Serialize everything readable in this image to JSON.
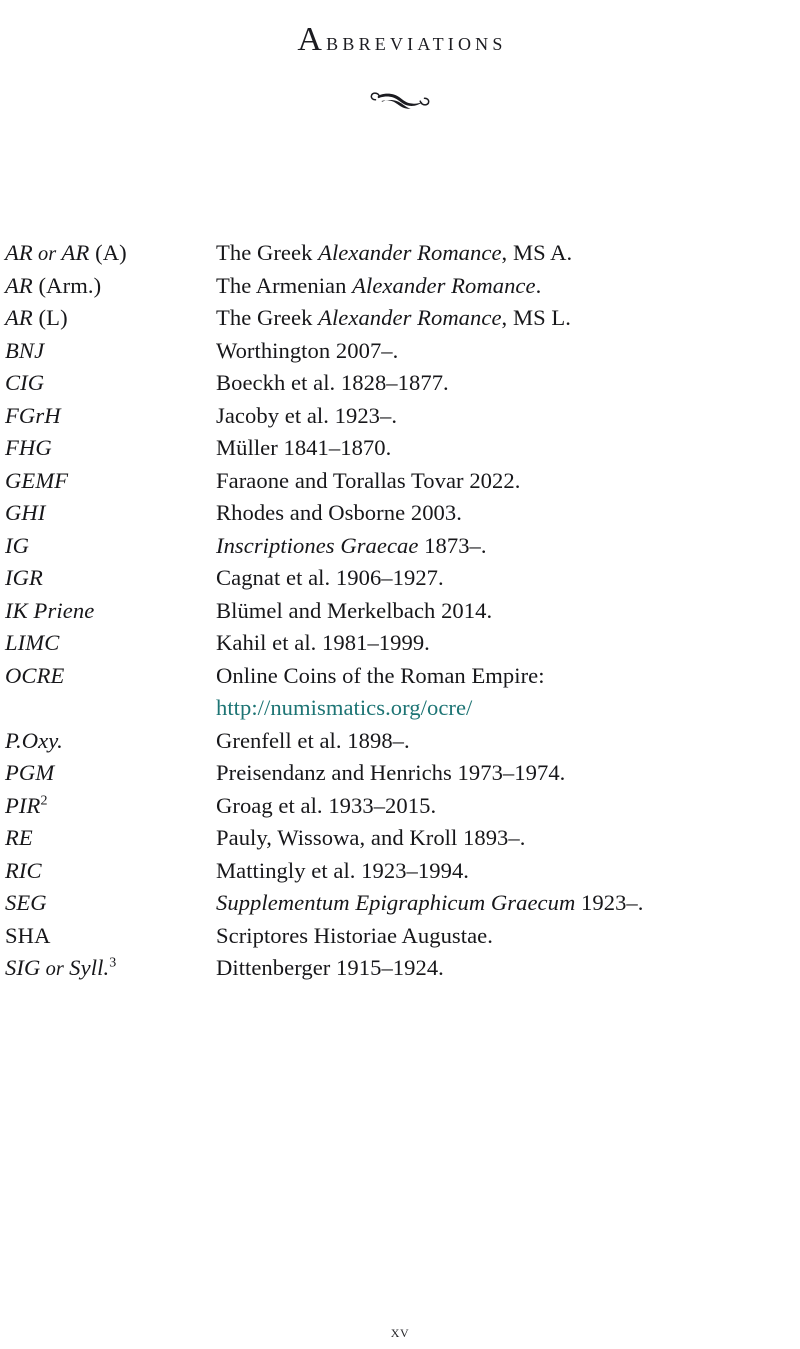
{
  "page": {
    "title_first_letter": "A",
    "title_rest": "bbreviations",
    "title_full": "Abbreviations",
    "folio": "xv",
    "ornament_name": "swash-flourish-ornament",
    "link_color": "#1d7474",
    "text_color": "#17171a",
    "background_color": "#ffffff"
  },
  "entries": [
    {
      "term_parts": [
        {
          "text": "AR",
          "style": "italic"
        },
        {
          "text": " or ",
          "style": "conj"
        },
        {
          "text": "AR",
          "style": "italic"
        },
        {
          "text": " (A)",
          "style": "roman"
        }
      ],
      "term_plain": "AR or AR (A)",
      "def_parts": [
        {
          "text": "The Greek ",
          "style": "roman"
        },
        {
          "text": "Alexander Romance",
          "style": "italic"
        },
        {
          "text": ", MS A.",
          "style": "roman"
        }
      ],
      "def_plain": "The Greek Alexander Romance, MS A."
    },
    {
      "term_parts": [
        {
          "text": "AR",
          "style": "italic"
        },
        {
          "text": " (Arm.)",
          "style": "roman"
        }
      ],
      "term_plain": "AR (Arm.)",
      "def_parts": [
        {
          "text": "The Armenian ",
          "style": "roman"
        },
        {
          "text": "Alexander Romance",
          "style": "italic"
        },
        {
          "text": ".",
          "style": "roman"
        }
      ],
      "def_plain": "The Armenian Alexander Romance."
    },
    {
      "term_parts": [
        {
          "text": "AR",
          "style": "italic"
        },
        {
          "text": " (L)",
          "style": "roman"
        }
      ],
      "term_plain": "AR (L)",
      "def_parts": [
        {
          "text": "The Greek ",
          "style": "roman"
        },
        {
          "text": "Alexander Romance",
          "style": "italic"
        },
        {
          "text": ", MS L.",
          "style": "roman"
        }
      ],
      "def_plain": "The Greek Alexander Romance, MS L."
    },
    {
      "term_parts": [
        {
          "text": "BNJ",
          "style": "italic"
        }
      ],
      "term_plain": "BNJ",
      "def_parts": [
        {
          "text": "Worthington 2007–.",
          "style": "roman"
        }
      ],
      "def_plain": "Worthington 2007–."
    },
    {
      "term_parts": [
        {
          "text": "CIG",
          "style": "italic"
        }
      ],
      "term_plain": "CIG",
      "def_parts": [
        {
          "text": "Boeckh et al. 1828–1877.",
          "style": "roman"
        }
      ],
      "def_plain": "Boeckh et al. 1828–1877."
    },
    {
      "term_parts": [
        {
          "text": "FGrH",
          "style": "italic"
        }
      ],
      "term_plain": "FGrH",
      "def_parts": [
        {
          "text": "Jacoby et al. 1923–.",
          "style": "roman"
        }
      ],
      "def_plain": "Jacoby et al. 1923–."
    },
    {
      "term_parts": [
        {
          "text": "FHG",
          "style": "italic"
        }
      ],
      "term_plain": "FHG",
      "def_parts": [
        {
          "text": "Müller 1841–1870.",
          "style": "roman"
        }
      ],
      "def_plain": "Müller 1841–1870."
    },
    {
      "term_parts": [
        {
          "text": "GEMF",
          "style": "italic"
        }
      ],
      "term_plain": "GEMF",
      "def_parts": [
        {
          "text": "Faraone and Torallas Tovar 2022.",
          "style": "roman"
        }
      ],
      "def_plain": "Faraone and Torallas Tovar 2022."
    },
    {
      "term_parts": [
        {
          "text": "GHI",
          "style": "italic"
        }
      ],
      "term_plain": "GHI",
      "def_parts": [
        {
          "text": "Rhodes and Osborne 2003.",
          "style": "roman"
        }
      ],
      "def_plain": "Rhodes and Osborne 2003."
    },
    {
      "term_parts": [
        {
          "text": "IG",
          "style": "italic"
        }
      ],
      "term_plain": "IG",
      "def_parts": [
        {
          "text": "Inscriptiones Graecae",
          "style": "italic"
        },
        {
          "text": " 1873–.",
          "style": "roman"
        }
      ],
      "def_plain": "Inscriptiones Graecae 1873–."
    },
    {
      "term_parts": [
        {
          "text": "IGR",
          "style": "italic"
        }
      ],
      "term_plain": "IGR",
      "def_parts": [
        {
          "text": "Cagnat et al. 1906–1927.",
          "style": "roman"
        }
      ],
      "def_plain": "Cagnat et al. 1906–1927."
    },
    {
      "term_parts": [
        {
          "text": "IK Priene",
          "style": "italic"
        }
      ],
      "term_plain": "IK Priene",
      "def_parts": [
        {
          "text": "Blümel and Merkelbach 2014.",
          "style": "roman"
        }
      ],
      "def_plain": "Blümel and Merkelbach 2014."
    },
    {
      "term_parts": [
        {
          "text": "LIMC",
          "style": "italic"
        }
      ],
      "term_plain": "LIMC",
      "def_parts": [
        {
          "text": "Kahil et al. 1981–1999.",
          "style": "roman"
        }
      ],
      "def_plain": "Kahil et al. 1981–1999."
    },
    {
      "term_parts": [
        {
          "text": "OCRE",
          "style": "italic"
        }
      ],
      "term_plain": "OCRE",
      "def_parts": [
        {
          "text": "Online Coins of the Roman Empire: ",
          "style": "roman"
        },
        {
          "text": "http://numismatics.org/ocre/",
          "style": "link"
        }
      ],
      "def_plain": "Online Coins of the Roman Empire: http://numismatics.org/ocre/"
    },
    {
      "term_parts": [
        {
          "text": "P.Oxy.",
          "style": "italic"
        }
      ],
      "term_plain": "P.Oxy.",
      "def_parts": [
        {
          "text": "Grenfell et al. 1898–.",
          "style": "roman"
        }
      ],
      "def_plain": "Grenfell et al. 1898–."
    },
    {
      "term_parts": [
        {
          "text": "PGM",
          "style": "italic"
        }
      ],
      "term_plain": "PGM",
      "def_parts": [
        {
          "text": "Preisendanz and Henrichs 1973–1974.",
          "style": "roman"
        }
      ],
      "def_plain": "Preisendanz and Henrichs 1973–1974."
    },
    {
      "term_parts": [
        {
          "text": "PIR",
          "style": "italic"
        },
        {
          "text": "2",
          "style": "sup"
        }
      ],
      "term_plain": "PIR2",
      "def_parts": [
        {
          "text": "Groag et al. 1933–2015.",
          "style": "roman"
        }
      ],
      "def_plain": "Groag et al. 1933–2015."
    },
    {
      "term_parts": [
        {
          "text": "RE",
          "style": "italic"
        }
      ],
      "term_plain": "RE",
      "def_parts": [
        {
          "text": "Pauly, Wissowa, and Kroll 1893–.",
          "style": "roman"
        }
      ],
      "def_plain": "Pauly, Wissowa, and Kroll 1893–."
    },
    {
      "term_parts": [
        {
          "text": "RIC",
          "style": "italic"
        }
      ],
      "term_plain": "RIC",
      "def_parts": [
        {
          "text": "Mattingly et al. 1923–1994.",
          "style": "roman"
        }
      ],
      "def_plain": "Mattingly et al. 1923–1994."
    },
    {
      "term_parts": [
        {
          "text": "SEG",
          "style": "italic"
        }
      ],
      "term_plain": "SEG",
      "def_parts": [
        {
          "text": "Supplementum Epigraphicum Graecum",
          "style": "italic"
        },
        {
          "text": " 1923–.",
          "style": "roman"
        }
      ],
      "def_plain": "Supplementum Epigraphicum Graecum 1923–."
    },
    {
      "term_parts": [
        {
          "text": "SHA",
          "style": "roman"
        }
      ],
      "term_plain": "SHA",
      "def_parts": [
        {
          "text": "Scriptores Historiae Augustae.",
          "style": "roman"
        }
      ],
      "def_plain": "Scriptores Historiae Augustae."
    },
    {
      "term_parts": [
        {
          "text": "SIG",
          "style": "italic"
        },
        {
          "text": " or ",
          "style": "conj"
        },
        {
          "text": "Syll.",
          "style": "italic"
        },
        {
          "text": "3",
          "style": "sup"
        }
      ],
      "term_plain": "SIG or Syll.3",
      "def_parts": [
        {
          "text": "Dittenberger 1915–1924.",
          "style": "roman"
        }
      ],
      "def_plain": "Dittenberger 1915–1924."
    }
  ]
}
